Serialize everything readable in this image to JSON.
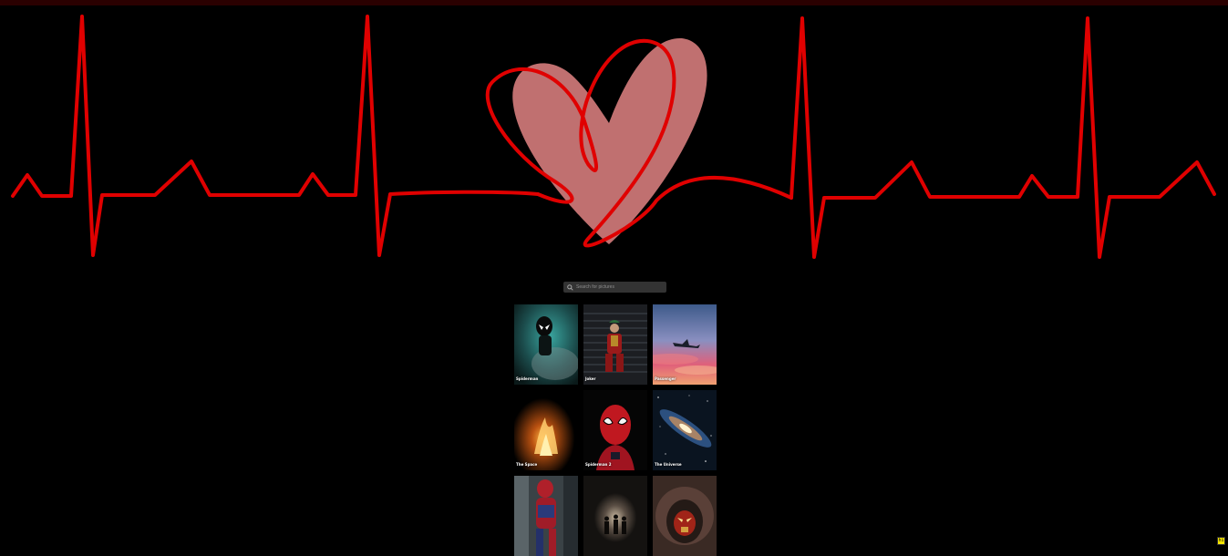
{
  "search": {
    "placeholder": "Search for pictures",
    "icon": "search-icon"
  },
  "colors": {
    "background": "#000000",
    "heartbeat_line": "#e00000",
    "heart_fill": "#c07070"
  },
  "gallery": {
    "items": [
      {
        "caption": "Spiderman"
      },
      {
        "caption": "Joker"
      },
      {
        "caption": "Passenger"
      },
      {
        "caption": "The Space"
      },
      {
        "caption": "Spiderman 2"
      },
      {
        "caption": "The Universe"
      },
      {
        "caption": ""
      },
      {
        "caption": ""
      },
      {
        "caption": ""
      }
    ]
  },
  "badge": {
    "label": "hi"
  }
}
